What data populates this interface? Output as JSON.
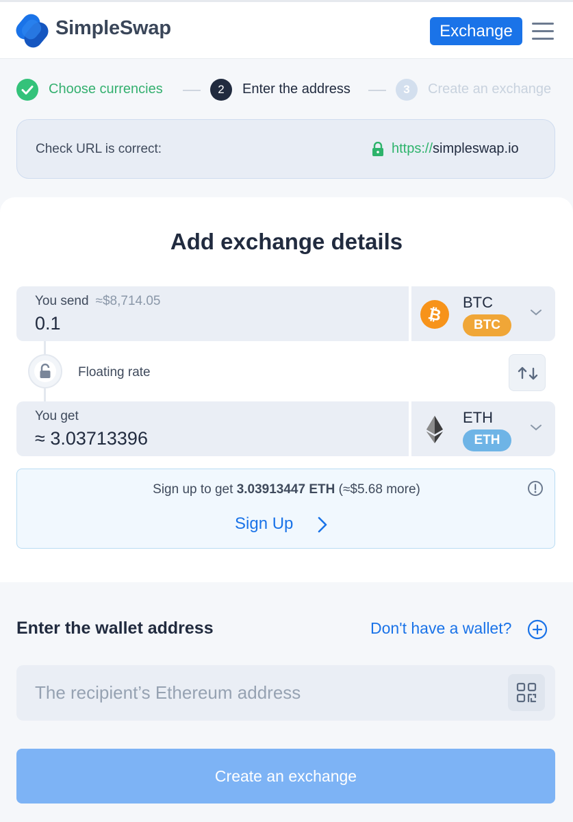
{
  "header": {
    "brand": "SimpleSwap",
    "exchange_button": "Exchange",
    "menu_icon": "hamburger-menu-icon"
  },
  "steps": [
    {
      "number": "1",
      "label": "Choose currencies",
      "status": "done",
      "icon": "check-icon"
    },
    {
      "number": "2",
      "label": "Enter the address",
      "status": "active"
    },
    {
      "number": "3",
      "label": "Create an exchange",
      "status": "upcoming"
    }
  ],
  "url_check": {
    "label": "Check URL is correct:",
    "scheme": "https://",
    "domain": "simpleswap.io",
    "icon": "lock-icon"
  },
  "exchange": {
    "title": "Add exchange details",
    "send": {
      "label": "You send",
      "usd_estimate": "≈$8,714.05",
      "amount": "0.1",
      "currency": "BTC",
      "badge": "BTC",
      "badge_color": "#f0a637",
      "icon": "bitcoin-icon"
    },
    "rate": {
      "label": "Floating rate",
      "icon": "unlock-icon",
      "swap_icon": "swap-arrows-icon"
    },
    "get": {
      "label": "You get",
      "amount": "≈ 3.03713396",
      "currency": "ETH",
      "badge": "ETH",
      "badge_color": "#6eb4e6",
      "icon": "ethereum-icon"
    },
    "signup": {
      "prefix": "Sign up to get",
      "amount": "3.03913447 ETH",
      "suffix": "(≈$5.68 more)",
      "link": "Sign Up"
    }
  },
  "wallet": {
    "title": "Enter the wallet address",
    "no_wallet_link": "Don't have a wallet?",
    "placeholder": "The recipient’s Ethereum address",
    "qr_icon": "qr-code-icon"
  },
  "create_button": "Create an exchange",
  "colors": {
    "accent": "#1a73e8",
    "success": "#2db36b",
    "dark": "#212b3f"
  }
}
